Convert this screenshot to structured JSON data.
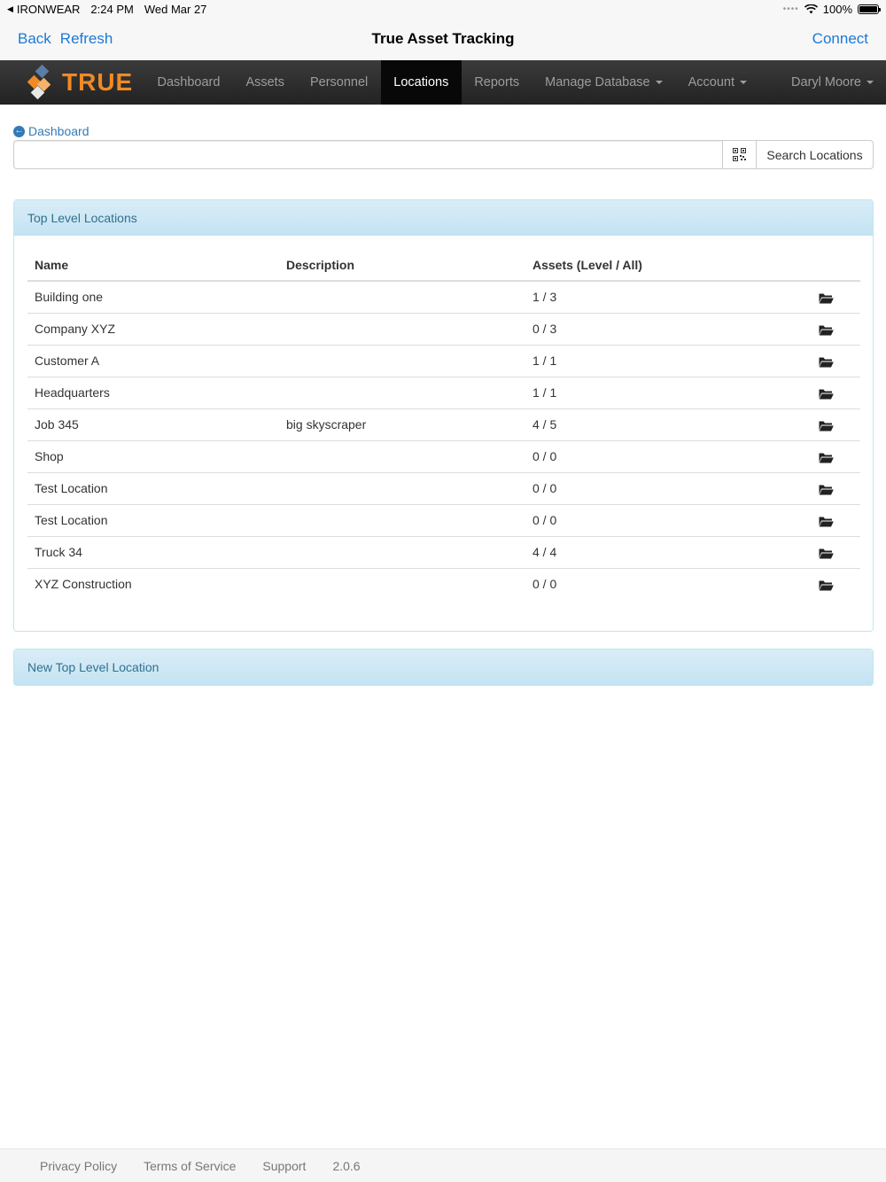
{
  "status_bar": {
    "carrier": "IRONWEAR",
    "time": "2:24 PM",
    "date": "Wed Mar 27",
    "battery": "100%"
  },
  "ios_nav": {
    "back": "Back",
    "refresh": "Refresh",
    "title": "True Asset Tracking",
    "connect": "Connect"
  },
  "app_nav": {
    "brand": "TRUE",
    "items": [
      {
        "label": "Dashboard"
      },
      {
        "label": "Assets"
      },
      {
        "label": "Personnel"
      },
      {
        "label": "Locations",
        "active": true
      },
      {
        "label": "Reports"
      },
      {
        "label": "Manage Database"
      },
      {
        "label": "Account"
      }
    ],
    "user": "Daryl Moore"
  },
  "breadcrumb": {
    "label": "Dashboard"
  },
  "search": {
    "value": "",
    "button": "Search Locations"
  },
  "locations_panel": {
    "title": "Top Level Locations",
    "columns": [
      "Name",
      "Description",
      "Assets (Level / All)",
      ""
    ],
    "rows": [
      {
        "name": "Building one",
        "description": "",
        "assets": "1 / 3"
      },
      {
        "name": "Company XYZ",
        "description": "",
        "assets": "0 / 3"
      },
      {
        "name": "Customer A",
        "description": "",
        "assets": "1 / 1"
      },
      {
        "name": "Headquarters",
        "description": "",
        "assets": "1 / 1"
      },
      {
        "name": "Job 345",
        "description": "big skyscraper",
        "assets": "4 / 5"
      },
      {
        "name": "Shop",
        "description": "",
        "assets": "0 / 0"
      },
      {
        "name": "Test Location",
        "description": "",
        "assets": "0 / 0"
      },
      {
        "name": "Test Location",
        "description": "",
        "assets": "0 / 0"
      },
      {
        "name": "Truck 34",
        "description": "",
        "assets": "4 / 4"
      },
      {
        "name": "XYZ Construction",
        "description": "",
        "assets": "0 / 0"
      }
    ]
  },
  "new_panel": {
    "title": "New Top Level Location"
  },
  "footer": {
    "privacy": "Privacy Policy",
    "terms": "Terms of Service",
    "support": "Support",
    "version": "2.0.6"
  },
  "colors": {
    "link_blue": "#337ab7",
    "ios_blue": "#1a7ad9",
    "brand_orange": "#f08a24",
    "nav_dark": "#222222",
    "panel_info": "#d9edf7"
  }
}
